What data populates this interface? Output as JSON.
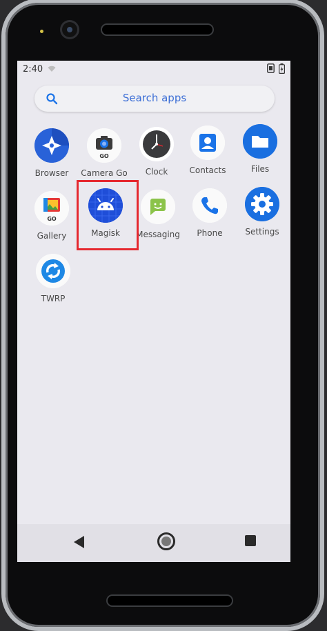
{
  "status_bar": {
    "time": "2:40"
  },
  "search": {
    "placeholder": "Search apps"
  },
  "apps": [
    {
      "label": "Browser"
    },
    {
      "label": "Camera Go"
    },
    {
      "label": "Clock"
    },
    {
      "label": "Contacts"
    },
    {
      "label": "Files"
    },
    {
      "label": "Gallery"
    },
    {
      "label": "Magisk"
    },
    {
      "label": "Messaging"
    },
    {
      "label": "Phone"
    },
    {
      "label": "Settings"
    },
    {
      "label": "TWRP"
    }
  ],
  "colors": {
    "accent_blue": "#1a73e8",
    "highlight_red": "#e5282f",
    "screen_bg": "#eae9ef"
  },
  "icons": {
    "browser": "compass-icon",
    "camera": "camera-icon",
    "clock": "clock-icon",
    "contacts": "contact-card-icon",
    "files": "folder-icon",
    "gallery": "gallery-icon",
    "magisk": "android-icon",
    "messaging": "message-bubble-icon",
    "phone": "phone-handset-icon",
    "settings": "gear-icon",
    "twrp": "twrp-refresh-icon"
  }
}
